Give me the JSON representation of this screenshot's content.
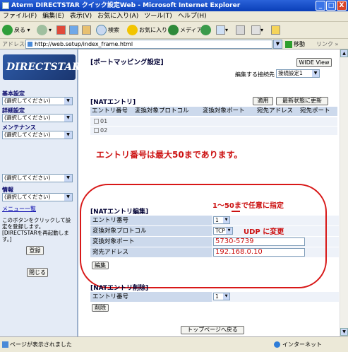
{
  "window": {
    "title": "Aterm DIRECTSTAR クイック設定Web - Microsoft Internet Explorer",
    "min": "_",
    "max": "□",
    "close": "X"
  },
  "menu": [
    "ファイル(F)",
    "編集(E)",
    "表示(V)",
    "お気に入り(A)",
    "ツール(T)",
    "ヘルプ(H)"
  ],
  "toolbar": {
    "back": "戻る",
    "search": "検索",
    "favorites": "お気に入り",
    "media": "メディア"
  },
  "address": {
    "label": "アドレス(D)",
    "url": "http://web.setup/index_frame.html",
    "go": "移動",
    "links": "リンク »"
  },
  "sidebar": {
    "logo": "DIRECTSTAR",
    "groups": [
      {
        "label": "基本設定",
        "select": "(選択してください)"
      },
      {
        "label": "詳細設定",
        "select": "(選択してください)"
      },
      {
        "label": "メンテナンス",
        "select": "(選択してください)"
      },
      {
        "label": "",
        "select": "(選択してください)"
      },
      {
        "label": "情報",
        "select": "(選択してください)"
      }
    ],
    "menu_all": "メニュー一覧",
    "note": "このボタンをクリックして設定を登録します。[DIRECTSTARを再起動します。]",
    "register_btn": "登録",
    "close_btn": "閉じる"
  },
  "main": {
    "heading": "[ポートマッピング設定]",
    "wide_btn": "WIDE View",
    "conn_label": "編集する接続先",
    "conn_value": "接続設定1",
    "nat_title": "[NATエントリ]",
    "apply_btn": "適用",
    "refresh_btn": "最新状態に更新",
    "nat_columns": [
      "エントリ番号",
      "変換対象プロトコル",
      "変換対象ポート",
      "宛先アドレス",
      "宛先ポート"
    ],
    "nat_rows": [
      "01",
      "02"
    ],
    "big_note": "エントリ番号は最大50まであります。",
    "edit_title": "[NATエントリ編集]",
    "fields": {
      "entry_label": "エントリ番号",
      "entry_value": "1",
      "protocol_label": "変換対象プロトコル",
      "protocol_value": "TCP",
      "port_label": "変換対象ポート",
      "port_value": "5730-5739",
      "dest_label": "宛先アドレス",
      "dest_value": "192.168.0.10"
    },
    "edit_btn": "編集",
    "anno_range": "1～50まで任意に指定",
    "anno_udp": "UDP に変更",
    "delete_title": "[NATエントリ削除]",
    "delete_entry_label": "エントリ番号",
    "delete_entry_value": "1",
    "delete_btn": "削除",
    "top_btn": "トップページへ戻る"
  },
  "status": {
    "text": "ページが表示されました",
    "zone": "インターネット"
  },
  "colors": {
    "title_bar": "#0a3fb8",
    "annotation": "#cc1111",
    "table_header": "#ccd9ec",
    "table_row": "#eef2f9"
  }
}
